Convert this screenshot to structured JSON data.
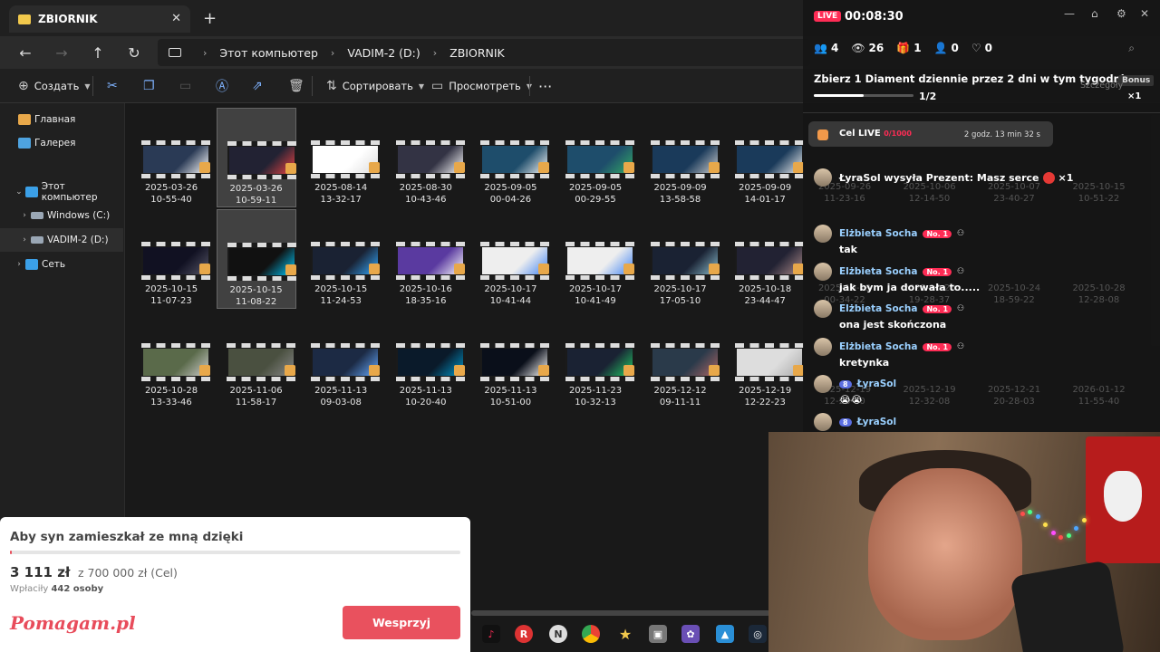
{
  "explorer": {
    "tab_title": "ZBIORNIK",
    "tab_close": "✕",
    "new_tab": "+",
    "breadcrumb": [
      "Этот компьютер",
      "VADIM-2 (D:)",
      "ZBIORNIK"
    ],
    "toolbar": {
      "create": "Создать",
      "sort": "Сортировать",
      "view": "Просмотреть",
      "more": "···"
    },
    "sidebar": [
      {
        "label": "Главная",
        "icon": "home-icon"
      },
      {
        "label": "Галерея",
        "icon": "gallery-icon"
      },
      {
        "label": "Этот компьютер",
        "icon": "pc-icon"
      },
      {
        "label": "Windows (C:)",
        "icon": "drive-icon"
      },
      {
        "label": "VADIM-2 (D:)",
        "icon": "drive-icon"
      },
      {
        "label": "Сеть",
        "icon": "network-icon"
      }
    ],
    "files": [
      [
        "2025-03-26",
        "10-55-40"
      ],
      [
        "2025-03-26",
        "10-59-11"
      ],
      [
        "2025-08-14",
        "13-32-17"
      ],
      [
        "2025-08-30",
        "10-43-46"
      ],
      [
        "2025-09-05",
        "00-04-26"
      ],
      [
        "2025-09-05",
        "00-29-55"
      ],
      [
        "2025-09-09",
        "13-58-58"
      ],
      [
        "2025-09-09",
        "14-01-17"
      ],
      [
        "2025-10-15",
        "11-07-23"
      ],
      [
        "2025-10-15",
        "11-08-22"
      ],
      [
        "2025-10-15",
        "11-24-53"
      ],
      [
        "2025-10-16",
        "18-35-16"
      ],
      [
        "2025-10-17",
        "10-41-44"
      ],
      [
        "2025-10-17",
        "10-41-49"
      ],
      [
        "2025-10-17",
        "17-05-10"
      ],
      [
        "2025-10-18",
        "23-44-47"
      ],
      [
        "2025-10-28",
        "13-33-46"
      ],
      [
        "2025-11-06",
        "11-58-17"
      ],
      [
        "2025-11-13",
        "09-03-08"
      ],
      [
        "2025-11-13",
        "10-20-40"
      ],
      [
        "2025-11-13",
        "10-51-00"
      ],
      [
        "2025-11-23",
        "10-32-13"
      ],
      [
        "2025-12-12",
        "09-11-11"
      ],
      [
        "2025-12-19",
        "12-22-23"
      ]
    ],
    "ghost_files": [
      [
        "2025-09-26",
        "11-23-16"
      ],
      [
        "2025-10-06",
        "12-14-50"
      ],
      [
        "2025-10-07",
        "23-40-27"
      ],
      [
        "2025-10-15",
        "10-51-22"
      ],
      [
        "2025-10-19",
        "00-34-22"
      ],
      [
        "2025-10-20",
        "19-28-37"
      ],
      [
        "2025-10-24",
        "18-59-22"
      ],
      [
        "2025-10-28",
        "12-28-08"
      ],
      [
        "2025-12-19",
        "12-28-40"
      ],
      [
        "2025-12-19",
        "12-32-08"
      ],
      [
        "2025-12-21",
        "20-28-03"
      ],
      [
        "2026-01-12",
        "11-55-40"
      ]
    ]
  },
  "live": {
    "badge": "LIVE",
    "timer": "00:08:30",
    "stats": {
      "members": "4",
      "viewers": "26",
      "gifts": "1",
      "shares": "0",
      "likes": "0"
    },
    "goal_text": "Zbierz 1 Diament dziennie przez 2 dni w tym tygodniu",
    "goal_count": "1/2",
    "goal_progress": 0.5,
    "bonus": "Bonus",
    "details": "Szczegóły",
    "multiplier": "×1",
    "cel_label": "Cel LIVE",
    "cel_progress": "0/1000",
    "cel_time": "2 godz. 13 min 32 s",
    "gift_message": "ŁyraSol wysyła Prezent: Masz serce",
    "gift_count": "×1",
    "messages": [
      {
        "user": "Elżbieta Socha",
        "badge": "No. 1",
        "text": "tak"
      },
      {
        "user": "Elżbieta Socha",
        "badge": "No. 1",
        "text": "jak bym ja dorwała to....."
      },
      {
        "user": "Elżbieta Socha",
        "badge": "No. 1",
        "text": "ona jest skończona"
      },
      {
        "user": "Elżbieta Socha",
        "badge": "No. 1",
        "text": "kretynka"
      },
      {
        "user": "ŁyraSol",
        "badge": "8",
        "text": "😭😭"
      },
      {
        "user": "ŁyraSol",
        "badge": "8",
        "text": ""
      }
    ]
  },
  "donate": {
    "title": "Aby syn zamieszkał ze mną dzięki",
    "raised": "3 111 zł",
    "goal": "z 700 000 zł (Cel)",
    "payers_label": "Wpłaciły",
    "payers_count": "442 osoby",
    "brand": "Pomagam.pl",
    "button": "Wesprzyj",
    "progress": 0.0044
  },
  "colors": {
    "accent": "#fe2c55",
    "donate_button": "#e9515e",
    "folder": "#f2c94c"
  }
}
